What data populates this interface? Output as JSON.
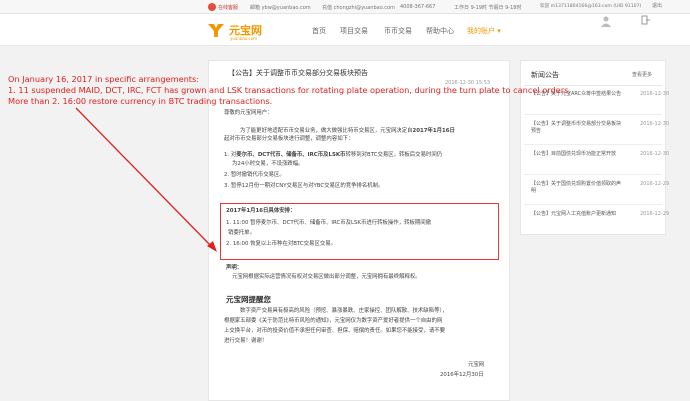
{
  "topbar": {
    "brand": "在线客服",
    "email": "邮箱 ybw@yuanbao.com",
    "qq": "充值 chongzhi@yuanbao.com",
    "phone": "4008-367-667",
    "hours": "工作日 9-19时 节假日 9-18时",
    "account": "欢迎 m13711804166@163.com (UID 91107)",
    "logout": "退出"
  },
  "nav": {
    "logo_text": "元宝网",
    "logo_sub": "yuanbao.com",
    "items": [
      "首页",
      "项目交易",
      "币币交易",
      "帮助中心",
      "我的账户 ▾"
    ]
  },
  "article": {
    "title": "【公告】关于调整币币交易部分交易板块预告",
    "date": "2016-12-30 15:53",
    "greeting": "尊敬的元宝网用户：",
    "p1_line1": "为了能更好地适配币币交易业务，做大做强比特币交易区，元宝网决定自",
    "p1_bold": "2017年1月16日",
    "p1_line2": "起对币币交易部分交易板块进行调整，调整内容如下：",
    "item1_a": "1.  对",
    "item1_bold": "麦尔币、DCT代币、储备币、IRC币及LSK币",
    "item1_b": "转移到对BTC交易区，转板后交易时间仍",
    "item1_c": "为24小时交易，不设涨跌幅。",
    "item2": "2.  暂时撤销代币交易区。",
    "item3": "3.  暂停12月份一期对CNY交易区与对YBC交易区的竞争排名机制。",
    "box_title": "2017年1月16日具体安排：",
    "box1": "1.  11:00  暂停麦尔币、DCT代币、储备币、IRC币及LSK币进行转板操作，转板期间撤",
    "box1b": "销委托单。",
    "box2": "2.  16:00  恢复以上币种在对BTC交易区交易。",
    "stmt_label": "声明：",
    "stmt": "元宝网根据实际运营情况有权对交易区做出部分调整，元宝网拥有最终解释权。",
    "h2": "元宝网提醒您",
    "r1": "数字资产交易具有极高的风险（预挖、暴涨暴跌、庄家操控、团队解散、技术缺陷等），",
    "r2": "根据家五部委《关于防范比特币风险的通知》，元宝网仅为数字资产爱好者提供一个自由的网",
    "r3": "上交换平台，对币的投资价值不承担任何审查、担保、赔偿的责任。如果您不能接受，请不要",
    "r4": "进行交易！谢谢！",
    "sign": "元宝网",
    "sign_date": "2016年12月30日"
  },
  "sidebar": {
    "title": "新闻公告",
    "more": "查看更多",
    "items": [
      {
        "title": "【公告】关于元宝ARC众筹中签结果公告",
        "date": "2016-12-30"
      },
      {
        "title": "【公告】关于调整币币交易部分交易板块预告",
        "date": "2016-12-30"
      },
      {
        "title": "【公告】目前国债兑现币功能正常开放",
        "date": "2016-12-30"
      },
      {
        "title": "【公告】关于国债兑现购置价值领取的声明",
        "date": "2016-12-29"
      },
      {
        "title": "【公告】元宝网人工充值账户更新通知",
        "date": "2016-12-29"
      }
    ]
  },
  "annotation": {
    "line1": "On January 16, 2017 in specific arrangements:",
    "line2": "1. 11 suspended MAID, DCT, IRC, FCT has grown and LSK transactions for rotating plate operation, during the turn plate to cancel orders.",
    "line3": "More than 2. 16:00 restore currency in BTC trading transactions."
  },
  "colors": {
    "accent": "#f39800",
    "annotation": "#e02020"
  }
}
